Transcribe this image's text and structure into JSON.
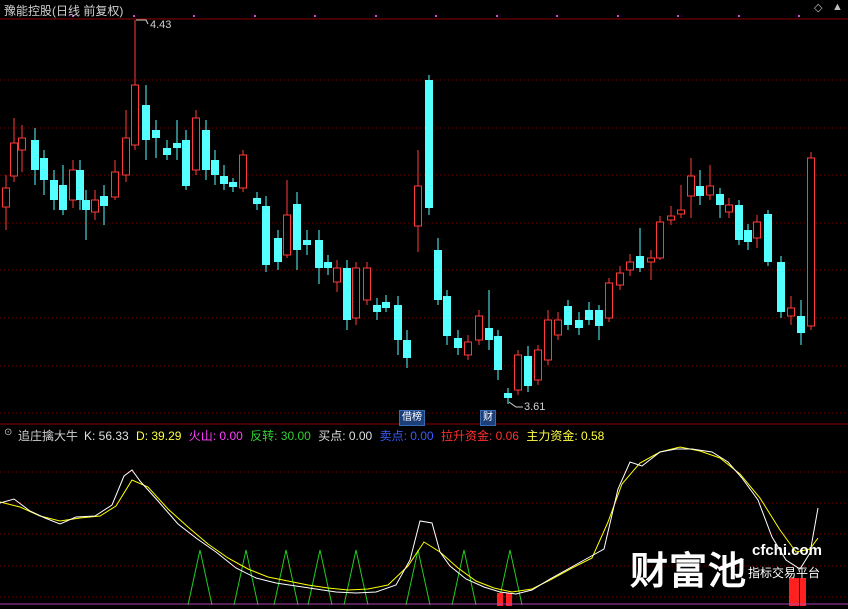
{
  "header": {
    "title": "豫能控股(日线 前复权)",
    "scroll_icon_label": "◇",
    "collapse_icon_label": "▲"
  },
  "price_chart": {
    "high_label": "4.43",
    "low_label": "3.61",
    "tags": [
      "借榜",
      "财"
    ],
    "high": 4.43,
    "low": 3.61
  },
  "indicator": {
    "name": "追庄擒大牛",
    "k": "K: 56.33",
    "d": "D: 39.29",
    "huoshan": "火山: 0.00",
    "fanzhuan": "反转: 30.00",
    "maidian": "买点: 0.00",
    "maichu": "卖点: 0.00",
    "lasheng": "拉升资金: 0.06",
    "zhuli": "主力资金: 0.58"
  },
  "colors": {
    "up": "#ff3b3b",
    "down": "#54ffff",
    "k_line": "#ffffff",
    "d_line": "#ffff00",
    "fanzhuan": "#22cc22",
    "lasheng": "#ff2020",
    "grid": "#7a0000"
  },
  "watermark": {
    "cn": "财富池",
    "en": "cfchi.com",
    "sub": "指标交易平台"
  }
}
